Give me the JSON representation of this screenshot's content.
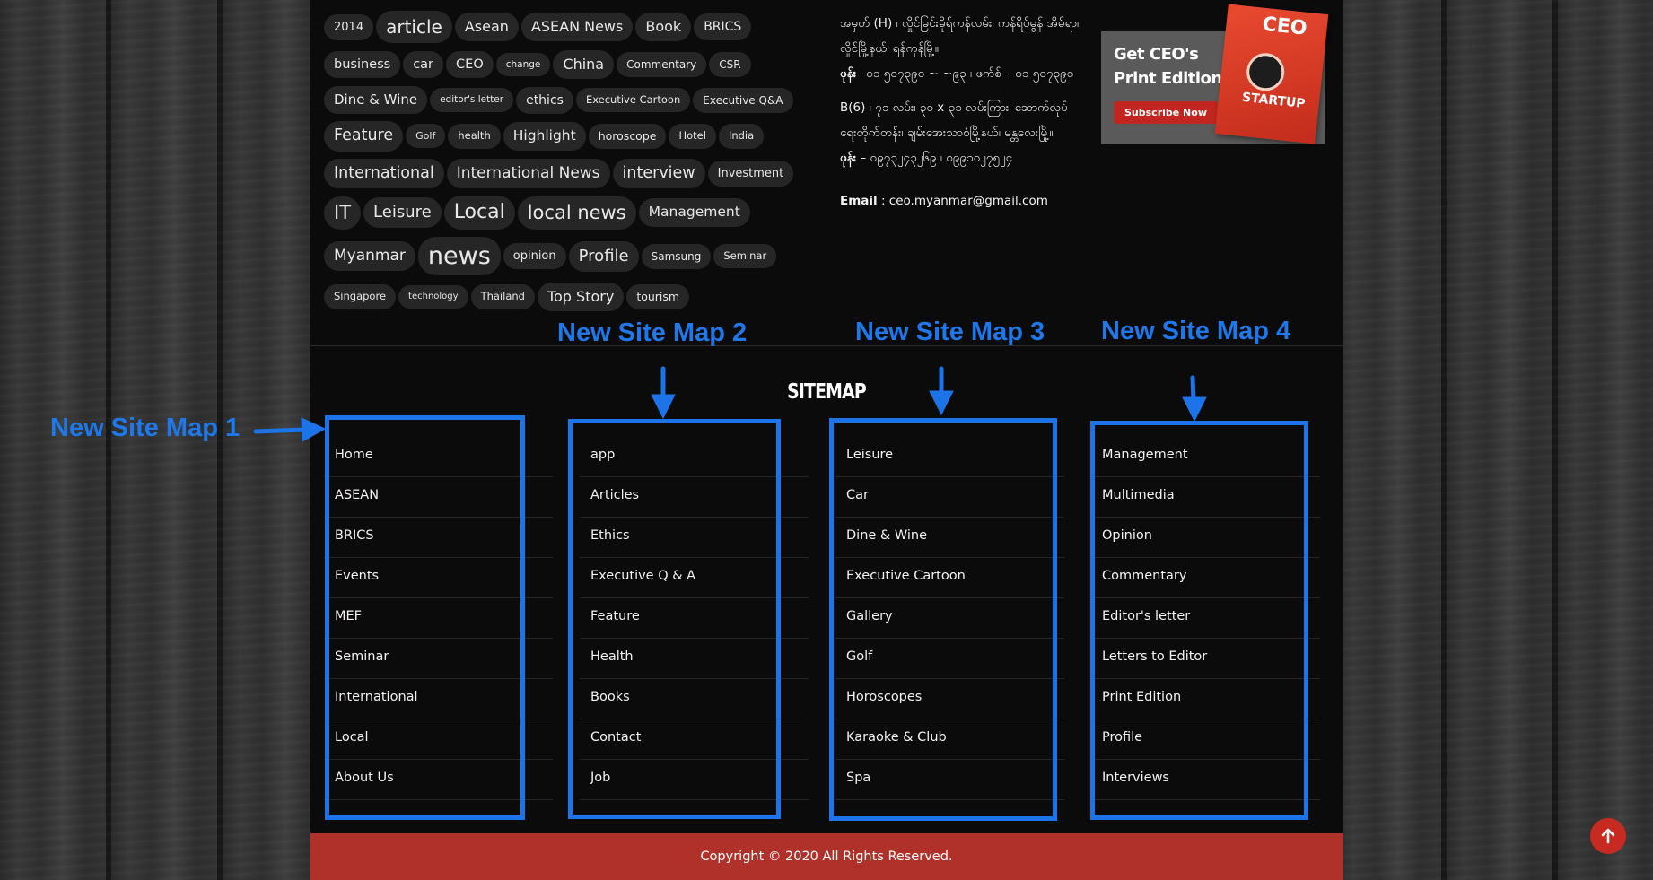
{
  "tags": [
    {
      "label": "2014",
      "size": 13
    },
    {
      "label": "article",
      "size": 20
    },
    {
      "label": "Asean",
      "size": 16
    },
    {
      "label": "ASEAN News",
      "size": 16
    },
    {
      "label": "Book",
      "size": 16
    },
    {
      "label": "BRICS",
      "size": 14
    },
    {
      "label": "business",
      "size": 14.5
    },
    {
      "label": "car",
      "size": 14.5
    },
    {
      "label": "CEO",
      "size": 14.5
    },
    {
      "label": "change",
      "size": 10.5
    },
    {
      "label": "China",
      "size": 16
    },
    {
      "label": "Commentary",
      "size": 12
    },
    {
      "label": "CSR",
      "size": 12
    },
    {
      "label": "Dine & Wine",
      "size": 15
    },
    {
      "label": "editor's letter",
      "size": 10.5
    },
    {
      "label": "ethics",
      "size": 14
    },
    {
      "label": "Executive Cartoon",
      "size": 11.5
    },
    {
      "label": "Executive Q&A",
      "size": 12
    },
    {
      "label": "Feature",
      "size": 17.5
    },
    {
      "label": "Golf",
      "size": 11
    },
    {
      "label": "health",
      "size": 11.5
    },
    {
      "label": "Highlight",
      "size": 15.5
    },
    {
      "label": "horoscope",
      "size": 12.5
    },
    {
      "label": "Hotel",
      "size": 11.5
    },
    {
      "label": "India",
      "size": 11.5
    },
    {
      "label": "International",
      "size": 17.5
    },
    {
      "label": "International News",
      "size": 17
    },
    {
      "label": "interview",
      "size": 17.5
    },
    {
      "label": "Investment",
      "size": 13
    },
    {
      "label": "IT",
      "size": 21
    },
    {
      "label": "Leisure",
      "size": 18
    },
    {
      "label": "Local",
      "size": 22
    },
    {
      "label": "local news",
      "size": 21
    },
    {
      "label": "Management",
      "size": 15.5
    },
    {
      "label": "Myanmar",
      "size": 17
    },
    {
      "label": "news",
      "size": 27
    },
    {
      "label": "opinion",
      "size": 13
    },
    {
      "label": "Profile",
      "size": 18
    },
    {
      "label": "Samsung",
      "size": 12
    },
    {
      "label": "Seminar",
      "size": 11.5
    },
    {
      "label": "Singapore",
      "size": 11.5
    },
    {
      "label": "technology",
      "size": 10
    },
    {
      "label": "Thailand",
      "size": 11.5
    },
    {
      "label": "Top Story",
      "size": 16
    },
    {
      "label": "tourism",
      "size": 12.5
    }
  ],
  "contact": {
    "address1": "အမှတ် (H) ၊ လှိုင်မြင်းမိုရ်ကန်လမ်း၊ ကန်ရိပ်မွန် အိမ်ရာ၊ လှိုင်မြို့နယ်၊ ရန်ကုန်မြို့။",
    "phone_label": "ဖုန်း",
    "phone1": " –၀၁ ၅၀၇၃၉၀ ~ ~၉၃ ၊ ဖက်စ် – ၀၁ ၅၀၇၃၉၀",
    "address2": "B(6) ၊ ၇၁ လမ်း၊ ၃၀ x ၃၁ လမ်းကြား၊ ဆောက်လုပ်ရေးတိုက်တန်း၊ ချမ်းအေးသာစံမြို့နယ်၊ မန္တလေးမြို့။",
    "phone2": " – ၀၉၇၃၂၄၃၂၆၉ ၊ ၀၉၉၁၀၂၇၅၂၄",
    "email_label": "Email",
    "email": " : ceo.myanmar@gmail.com"
  },
  "promo": {
    "title_line1": "Get CEO's",
    "title_line2": "Print Edition",
    "button": "Subscribe Now",
    "mag_logo": "CEO",
    "mag_word": "STARTUP"
  },
  "sitemap_title": "SITEMAP",
  "sitemap": {
    "col1": [
      "Home",
      "ASEAN",
      "BRICS",
      "Events",
      "MEF",
      "Seminar",
      "International",
      "Local",
      "About Us"
    ],
    "col2": [
      "app",
      "Articles",
      "Ethics",
      "Executive Q & A",
      "Feature",
      "Health",
      "Books",
      "Contact",
      "Job"
    ],
    "col3": [
      "Leisure",
      "Car",
      "Dine & Wine",
      "Executive Cartoon",
      "Gallery",
      "Golf",
      "Horoscopes",
      "Karaoke & Club",
      "Spa"
    ],
    "col4": [
      "Management",
      "Multimedia",
      "Opinion",
      "Commentary",
      "Editor's letter",
      "Letters to Editor",
      "Print Edition",
      "Profile",
      "Interviews"
    ]
  },
  "annotations": {
    "map1": "New Site Map 1",
    "map2": "New Site Map 2",
    "map3": "New Site Map 3",
    "map4": "New Site Map 4",
    "color": "#1d74e8"
  },
  "footer": "Copyright © 2020 All Rights Reserved.",
  "colors": {
    "footer": "#b0302a",
    "scroll_button": "#c72a20",
    "page": "#0b0b0c",
    "tag_bg": "#262626"
  },
  "scroll_top_icon": "arrow-up-icon"
}
